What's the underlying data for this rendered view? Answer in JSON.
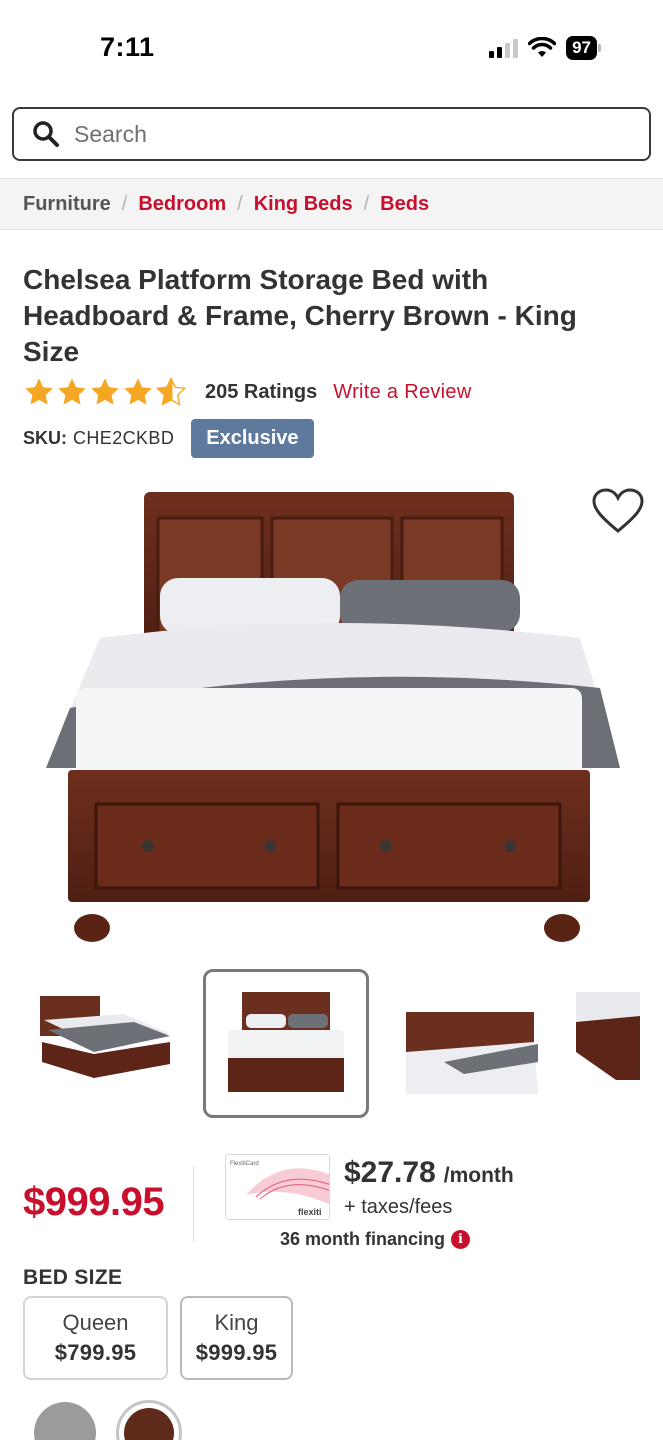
{
  "status_bar": {
    "time": "7:11",
    "battery": "97"
  },
  "search": {
    "placeholder": "Search"
  },
  "breadcrumb": [
    {
      "label": "Furniture"
    },
    {
      "label": "Bedroom"
    },
    {
      "label": "King Beds"
    },
    {
      "label": "Beds"
    }
  ],
  "product": {
    "title": "Chelsea Platform Storage Bed with Headboard & Frame, Cherry Brown - King Size",
    "rating": 4.5,
    "ratings_count": "205 Ratings",
    "write_review": "Write a Review",
    "sku_label": "SKU:",
    "sku_value": "CHE2CKBD",
    "badge": "Exclusive"
  },
  "gallery": {
    "selected_index": 1,
    "thumbnail_count": 4
  },
  "pricing": {
    "price": "$999.95",
    "monthly_amount": "$27.78",
    "monthly_unit": "/month",
    "taxes": "+ taxes/fees",
    "financing": "36 month financing",
    "card_brand": "flexiti",
    "card_title": "FlexitiCard"
  },
  "bed_size": {
    "label": "BED SIZE",
    "options": [
      {
        "name": "Queen",
        "price": "$799.95"
      },
      {
        "name": "King",
        "price": "$999.95"
      }
    ],
    "selected": "King"
  },
  "colors": {
    "accent": "#c8102e",
    "badge": "#5d7a9c",
    "swatch_grey": "#9b9b9b",
    "swatch_brown": "#5e2a1a"
  }
}
